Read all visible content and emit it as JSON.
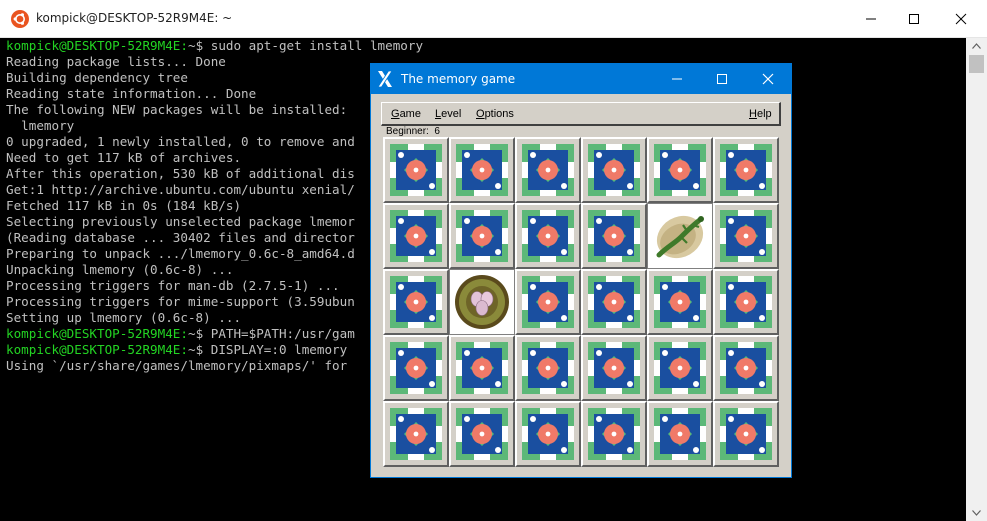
{
  "terminal": {
    "title": "kompick@DESKTOP-52R9M4E: ~",
    "lines": [
      {
        "prompt": "kompick@DESKTOP-52R9M4E:",
        "text": "~$ sudo apt-get install lmemory"
      },
      {
        "prompt": "",
        "text": "Reading package lists... Done"
      },
      {
        "prompt": "",
        "text": "Building dependency tree"
      },
      {
        "prompt": "",
        "text": "Reading state information... Done"
      },
      {
        "prompt": "",
        "text": "The following NEW packages will be installed:"
      },
      {
        "prompt": "",
        "text": "  lmemory"
      },
      {
        "prompt": "",
        "text": "0 upgraded, 1 newly installed, 0 to remove and"
      },
      {
        "prompt": "",
        "text": "Need to get 117 kB of archives."
      },
      {
        "prompt": "",
        "text": "After this operation, 530 kB of additional dis"
      },
      {
        "prompt": "",
        "text": "Get:1 http://archive.ubuntu.com/ubuntu xenial/"
      },
      {
        "prompt": "",
        "text": "Fetched 117 kB in 0s (184 kB/s)"
      },
      {
        "prompt": "",
        "text": "Selecting previously unselected package lmemor"
      },
      {
        "prompt": "",
        "text": "(Reading database ... 30402 files and director"
      },
      {
        "prompt": "",
        "text": "Preparing to unpack .../lmemory_0.6c-8_amd64.d"
      },
      {
        "prompt": "",
        "text": "Unpacking lmemory (0.6c-8) ..."
      },
      {
        "prompt": "",
        "text": "Processing triggers for man-db (2.7.5-1) ..."
      },
      {
        "prompt": "",
        "text": "Processing triggers for mime-support (3.59ubun"
      },
      {
        "prompt": "",
        "text": "Setting up lmemory (0.6c-8) ..."
      },
      {
        "prompt": "kompick@DESKTOP-52R9M4E:",
        "text": "~$ PATH=$PATH:/usr/gam"
      },
      {
        "prompt": "kompick@DESKTOP-52R9M4E:",
        "text": "~$ DISPLAY=:0 lmemory"
      },
      {
        "prompt": "",
        "text": "Using `/usr/share/games/lmemory/pixmaps/' for"
      }
    ]
  },
  "game": {
    "title": "The memory game",
    "menu": {
      "game": {
        "ul": "G",
        "rest": "ame"
      },
      "level": {
        "ul": "L",
        "rest": "evel"
      },
      "options": {
        "ul": "O",
        "rest": "ptions"
      },
      "help": {
        "ul": "H",
        "rest": "elp"
      }
    },
    "status": "Beginner:  6",
    "tiles": [
      [
        "back",
        "back",
        "back",
        "back",
        "back",
        "back"
      ],
      [
        "back",
        "back",
        "back",
        "back",
        "lizard",
        "back"
      ],
      [
        "back",
        "eggs",
        "back",
        "back",
        "back",
        "back"
      ],
      [
        "back",
        "back",
        "back",
        "back",
        "back",
        "back"
      ],
      [
        "back",
        "back",
        "back",
        "back",
        "back",
        "back"
      ]
    ]
  },
  "colors": {
    "tile_blue": "#1a4fa0",
    "tile_green": "#5cb878",
    "tile_salmon": "#f07a68",
    "titlebar_blue": "#0078d7",
    "prompt_green": "#23d423"
  }
}
